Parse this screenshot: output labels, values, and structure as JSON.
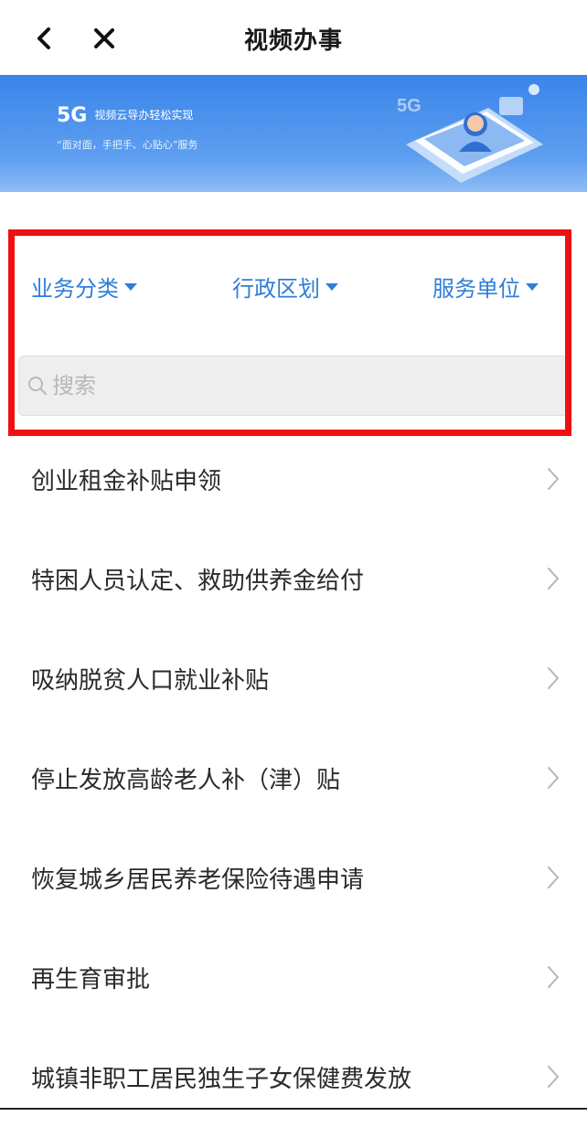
{
  "header": {
    "title": "视频办事",
    "back_icon": "chevron-left-icon",
    "close_icon": "close-icon"
  },
  "banner": {
    "big": "5G",
    "line1": "视频云导办轻松实现",
    "line2": "“面对面，手把手、心贴心”服务",
    "art_label": "5G"
  },
  "filters": {
    "category": "业务分类",
    "region": "行政区划",
    "unit": "服务单位"
  },
  "search": {
    "placeholder": "搜索",
    "value": ""
  },
  "items": [
    "创业租金补贴申领",
    "特困人员认定、救助供养金给付",
    "吸纳脱贫人口就业补贴",
    "停止发放高龄老人补（津）贴",
    "恢复城乡居民养老保险待遇申请",
    "再生育审批",
    "城镇非职工居民独生子女保健费发放"
  ],
  "colors": {
    "accent": "#2f7ed8",
    "highlight": "#ee1111",
    "banner": "#3a85ea"
  }
}
